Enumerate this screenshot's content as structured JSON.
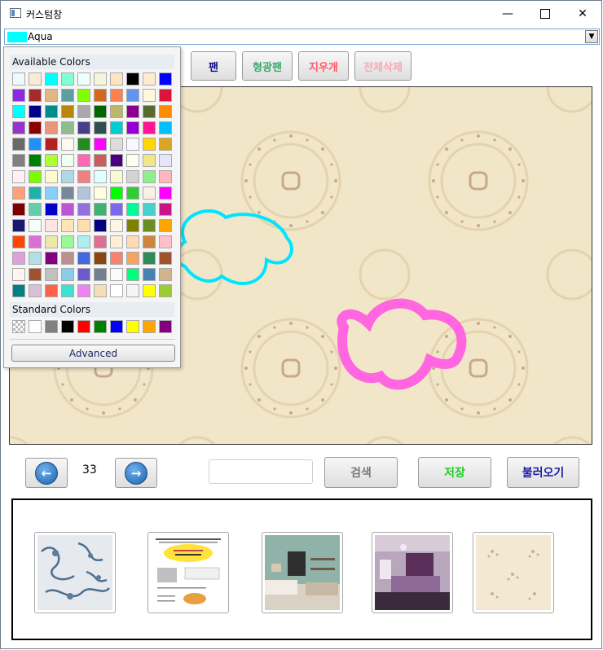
{
  "window": {
    "title": "커스텀창"
  },
  "color_picker": {
    "selected_name": "Aqua",
    "selected_color": "#00ffff",
    "available_title": "Available Colors",
    "standard_title": "Standard Colors",
    "advanced_label": "Advanced",
    "available_colors": [
      "#f0f8ff",
      "#faebd7",
      "#00ffff",
      "#7fffd4",
      "#f0ffff",
      "#f5f5dc",
      "#ffe4c4",
      "#000000",
      "#ffebcd",
      "#0000ff",
      "#8a2be2",
      "#a52a2a",
      "#deb887",
      "#5f9ea0",
      "#7fff00",
      "#d2691e",
      "#ff7f50",
      "#6495ed",
      "#fff8dc",
      "#dc143c",
      "#00ffff",
      "#00008b",
      "#008b8b",
      "#b8860b",
      "#a9a9a9",
      "#006400",
      "#bdb76b",
      "#8b008b",
      "#556b2f",
      "#ff8c00",
      "#9932cc",
      "#8b0000",
      "#e9967a",
      "#8fbc8f",
      "#483d8b",
      "#2f4f4f",
      "#00ced1",
      "#9400d3",
      "#ff1493",
      "#00bfff",
      "#696969",
      "#1e90ff",
      "#b22222",
      "#fffaf0",
      "#228b22",
      "#ff00ff",
      "#dcdcdc",
      "#f8f8ff",
      "#ffd700",
      "#daa520",
      "#808080",
      "#008000",
      "#adff2f",
      "#f0fff0",
      "#ff69b4",
      "#cd5c5c",
      "#4b0082",
      "#fffff0",
      "#f0e68c",
      "#e6e6fa",
      "#fff0f5",
      "#7cfc00",
      "#fffacd",
      "#add8e6",
      "#f08080",
      "#e0ffff",
      "#fafad2",
      "#d3d3d3",
      "#90ee90",
      "#ffb6c1",
      "#ffa07a",
      "#20b2aa",
      "#87cefa",
      "#778899",
      "#b0c4de",
      "#ffffe0",
      "#00ff00",
      "#32cd32",
      "#faf0e6",
      "#ff00ff",
      "#800000",
      "#66cdaa",
      "#0000cd",
      "#ba55d3",
      "#9370db",
      "#3cb371",
      "#7b68ee",
      "#00fa9a",
      "#48d1cc",
      "#c71585",
      "#191970",
      "#f5fffa",
      "#ffe4e1",
      "#ffe4b5",
      "#ffdead",
      "#000080",
      "#fdf5e6",
      "#808000",
      "#6b8e23",
      "#ffa500",
      "#ff4500",
      "#da70d6",
      "#eee8aa",
      "#98fb98",
      "#afeeee",
      "#db7093",
      "#ffefd5",
      "#ffdab9",
      "#cd853f",
      "#ffc0cb",
      "#dda0dd",
      "#b0e0e6",
      "#800080",
      "#bc8f8f",
      "#4169e1",
      "#8b4513",
      "#fa8072",
      "#f4a460",
      "#2e8b57",
      "#a0522d",
      "#fff5ee",
      "#a0522d",
      "#c0c0c0",
      "#87ceeb",
      "#6a5acd",
      "#708090",
      "#fffafa",
      "#00ff7f",
      "#4682b4",
      "#d2b48c",
      "#008080",
      "#d8bfd8",
      "#ff6347",
      "#40e0d0",
      "#ee82ee",
      "#f5deb3",
      "#ffffff",
      "#f5f5f5",
      "#ffff00",
      "#9acd32"
    ],
    "standard_colors": [
      "transparent",
      "#ffffff",
      "#808080",
      "#000000",
      "#ff0000",
      "#008000",
      "#0000ff",
      "#ffff00",
      "#ffa500",
      "#800080"
    ]
  },
  "toolbar": {
    "pen_label": "팬",
    "highlighter_label": "형광팬",
    "eraser_label": "지우개",
    "clear_all_label": "전체삭제"
  },
  "navigation": {
    "page_number": "33"
  },
  "search": {
    "placeholder": "",
    "button_label": "검색"
  },
  "actions": {
    "save_label": "저장",
    "load_label": "불러오기"
  },
  "colors": {
    "pen": "#0a0a8a",
    "highlighter": "#3aaa6a",
    "eraser": "#ff5a6a",
    "clear_all": "#f7a8b8",
    "search": "#7a7a7a",
    "save": "#22cc22",
    "load": "#1a1aaa",
    "stroke_cyan": "#00e5ff",
    "stroke_magenta": "#ff66e0"
  },
  "gallery": {
    "thumbnails": [
      {
        "name": "blue-floral-wallpaper"
      },
      {
        "name": "product-flyer"
      },
      {
        "name": "green-kitchen-room"
      },
      {
        "name": "purple-bedroom"
      },
      {
        "name": "beige-pattern-wallpaper"
      }
    ]
  }
}
